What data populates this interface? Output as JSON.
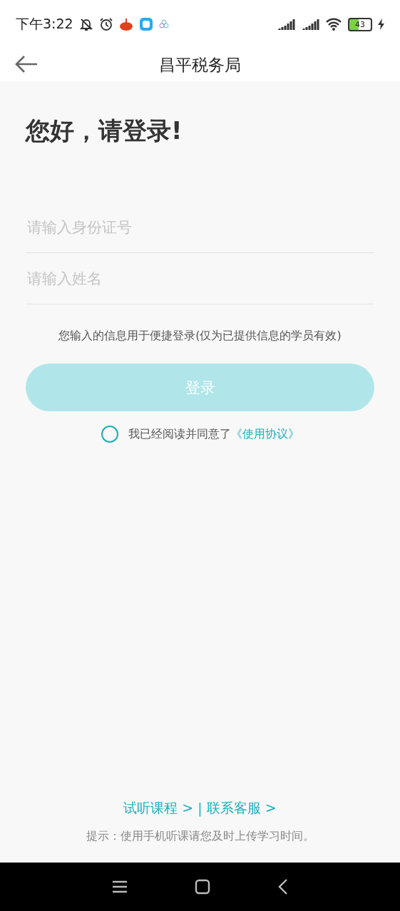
{
  "status_bar": {
    "time": "下午3:22",
    "battery": "43"
  },
  "header": {
    "title": "昌平税务局"
  },
  "greeting": "您好，请登录!",
  "fields": [
    {
      "placeholder": "请输入身份证号"
    },
    {
      "placeholder": "请输入姓名"
    }
  ],
  "note": "您输入的信息用于便捷登录(仅为已提供信息的学员有效)",
  "login_button": {
    "label": "登录",
    "disabled": true
  },
  "agreement": {
    "checked": false,
    "text": "我已经阅读并同意了",
    "link": "《使用协议》"
  },
  "footer": {
    "links": [
      "试听课程 >",
      "联系客服 >"
    ],
    "separator": "|",
    "tip": "提示：使用手机听课请您及时上传学习时间。"
  }
}
